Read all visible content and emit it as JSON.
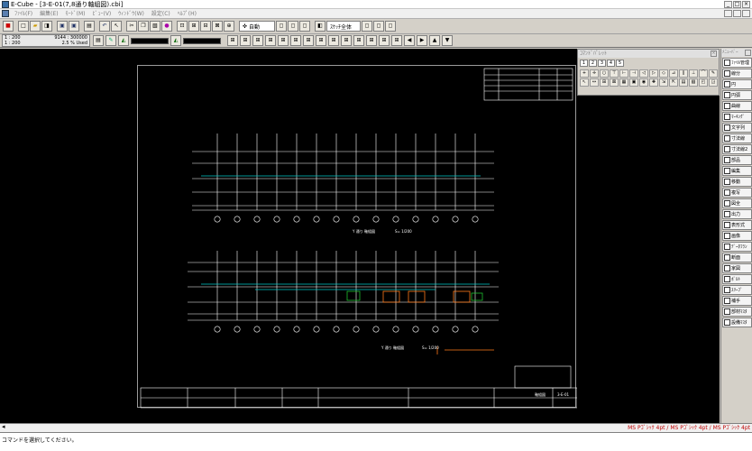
{
  "window": {
    "title": "E-Cube - [3-E-01(7,8通り軸組図).cbi]"
  },
  "menu": [
    {
      "label": "ﾌｧｲﾙ(F)"
    },
    {
      "label": "編集(E)"
    },
    {
      "label": "ﾓｰﾄﾞ(M)"
    },
    {
      "label": "ﾋﾞｭｰ(V)"
    },
    {
      "label": "ｳｨﾝﾄﾞｳ(W)"
    },
    {
      "label": "設定(C)"
    },
    {
      "label": "ﾍﾙﾌﾟ(H)"
    }
  ],
  "toolbar": {
    "snap_select": "自動",
    "layer_select": "ｽｹｯﾁ全体"
  },
  "info_panel": {
    "scale_top": "1 : 200",
    "coords": "9144 : 300000",
    "scale_bottom": "1 : 200",
    "usage": "2.5 % Used"
  },
  "palette": {
    "title": "ｺﾏﾝﾄﾞﾊﾟﾚｯﾄ",
    "tabs": [
      "1",
      "2",
      "3",
      "4",
      "5"
    ]
  },
  "right_panel": {
    "title": "ﾒﾆｭｰﾊﾞｰ",
    "items": [
      {
        "label": "ﾌｧｲﾙ管理",
        "icon": "file-manage-icon"
      },
      {
        "label": "線分",
        "icon": "line-icon"
      },
      {
        "label": "円",
        "icon": "circle-icon"
      },
      {
        "label": "円弧",
        "icon": "arc-icon"
      },
      {
        "label": "曲線",
        "icon": "curve-icon"
      },
      {
        "label": "ﾏｰｷﾝｸﾞ",
        "icon": "marking-icon"
      },
      {
        "label": "文字列",
        "icon": "text-icon"
      },
      {
        "label": "寸法線",
        "icon": "dimension-icon"
      },
      {
        "label": "寸法線2",
        "icon": "dimension2-icon"
      },
      {
        "label": "部品",
        "icon": "part-icon"
      },
      {
        "label": "編集",
        "icon": "edit-icon"
      },
      {
        "label": "移動",
        "icon": "move-icon"
      },
      {
        "label": "複写",
        "icon": "copy-icon"
      },
      {
        "label": "図全",
        "icon": "whole-icon"
      },
      {
        "label": "出力",
        "icon": "output-icon"
      },
      {
        "label": "表形式",
        "icon": "table-icon"
      },
      {
        "label": "画像",
        "icon": "image-icon"
      },
      {
        "label": "ﾃﾞｰﾀﾌﾗﾝ",
        "icon": "data-icon"
      },
      {
        "label": "断面",
        "icon": "section-icon"
      },
      {
        "label": "家図",
        "icon": "house-icon"
      },
      {
        "label": "ﾎﾞﾙﾄ",
        "icon": "bolt-icon"
      },
      {
        "label": "ｽﾘｰﾌﾞ",
        "icon": "sleeve-icon"
      },
      {
        "label": "補手",
        "icon": "joint-icon"
      },
      {
        "label": "部材ﾏｽﾀ",
        "icon": "member-master-icon"
      },
      {
        "label": "設備ﾏｽﾀ",
        "icon": "equipment-master-icon"
      }
    ]
  },
  "drawing": {
    "plan1_title": "Y 通り 軸組図",
    "plan1_scale": "S= 1/200",
    "plan2_title": "Y 通り 軸組図",
    "plan2_scale": "S= 1/200",
    "block_title": "軸組図",
    "sheet_no": "3-E-01"
  },
  "status": {
    "font_info": "MS Pｺﾞｼｯｸ 4pt / MS Pｺﾞｼｯｸ 4pt / MS Pｺﾞｼｯｸ 4pt",
    "command_prompt": "コマンドを選択してください。"
  },
  "colors": {
    "canvas": "#000000",
    "line_white": "#ffffff",
    "line_cyan": "#00c8c8",
    "line_orange": "#ff7a1a",
    "line_green": "#20c030",
    "accent_red": "#c00000"
  }
}
